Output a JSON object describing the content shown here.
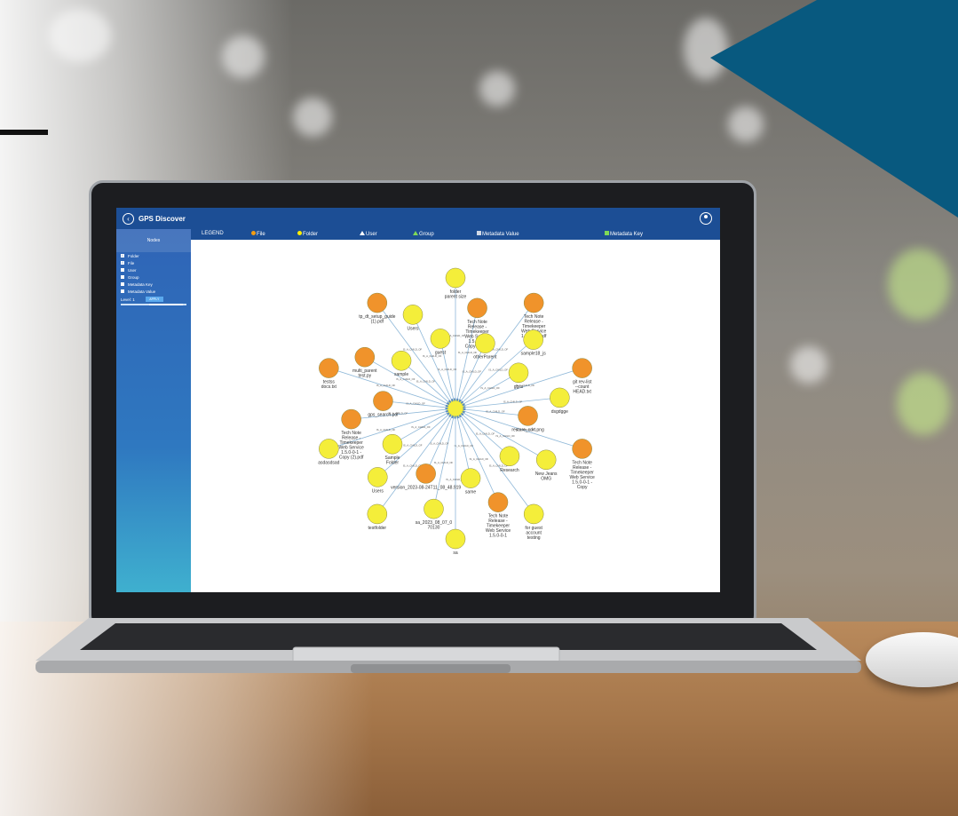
{
  "app": {
    "title": "GPS Discover"
  },
  "sidebar": {
    "header": "Nodes",
    "items": [
      {
        "label": "Folder",
        "checked": true
      },
      {
        "label": "File",
        "checked": true
      },
      {
        "label": "User",
        "checked": false
      },
      {
        "label": "Group",
        "checked": false
      },
      {
        "label": "Metadata Key",
        "checked": false
      },
      {
        "label": "Metadata Value",
        "checked": false
      }
    ],
    "level_label": "Level: 1",
    "apply_label": "APPLY"
  },
  "legend": {
    "title": "LEGEND",
    "items": [
      {
        "label": "File",
        "shape": "circle",
        "color": "#f39c12"
      },
      {
        "label": "Folder",
        "shape": "circle",
        "color": "#ffee00"
      },
      {
        "label": "User",
        "shape": "triangle",
        "color": "#ffffff"
      },
      {
        "label": "Group",
        "shape": "triangle",
        "color": "#7ed957"
      },
      {
        "label": "Metadata Value",
        "shape": "square",
        "color": "#cfd8e6"
      },
      {
        "label": "Metadata Key",
        "shape": "square",
        "color": "#7ed957"
      }
    ]
  },
  "graph": {
    "colors": {
      "file": "#f0932b",
      "folder": "#f4ee3a",
      "edge": "#8fb8d8"
    },
    "edge_label": "IS_A_CHILD_OF",
    "nodes": [
      {
        "type": "folder",
        "label": "folder parent size"
      },
      {
        "type": "file",
        "label": "Tech Note Release - Timekeeper Web Service 1.5.0-0-1 Copy (2).pdf"
      },
      {
        "type": "folder",
        "label": "otherParent"
      },
      {
        "type": "file",
        "label": "Tech Note Release - Timekeeper Web Service 1.5.0-0-1.pdf"
      },
      {
        "type": "folder",
        "label": "sample18_js"
      },
      {
        "type": "folder",
        "label": "ggss"
      },
      {
        "type": "file",
        "label": "git rev-list --count HEAD.txt"
      },
      {
        "type": "folder",
        "label": "dsgdgge"
      },
      {
        "type": "file",
        "label": "restore_cdrt.png"
      },
      {
        "type": "file",
        "label": "Tech Note Release - Timekeeper Web Service 1.5.0-0-1 - Copy"
      },
      {
        "type": "folder",
        "label": "New Jeans OMG"
      },
      {
        "type": "folder",
        "label": "Research"
      },
      {
        "type": "folder",
        "label": "for guest account testing"
      },
      {
        "type": "file",
        "label": "Tech Note Release - Timekeeper Web Service 1.5.0-0-1"
      },
      {
        "type": "folder",
        "label": "same"
      },
      {
        "type": "folder",
        "label": "sa"
      },
      {
        "type": "folder",
        "label": "sa_2023_08_07_0 70130"
      },
      {
        "type": "file",
        "label": "version_2023-08-24T11_08_48.919"
      },
      {
        "type": "folder",
        "label": "testfolder"
      },
      {
        "type": "folder",
        "label": "Users"
      },
      {
        "type": "folder",
        "label": "Sample Folder"
      },
      {
        "type": "folder",
        "label": "asdasdsad"
      },
      {
        "type": "file",
        "label": "Tech Note Release - Timekeeper Web Service 1.5.0-0-1 - Copy (2).pdf"
      },
      {
        "type": "file",
        "label": "gps_search.pdf"
      },
      {
        "type": "file",
        "label": "testss docs.txt"
      },
      {
        "type": "file",
        "label": "multi_parent test.py"
      },
      {
        "type": "folder",
        "label": "sample"
      },
      {
        "type": "file",
        "label": "tp_dt_setup_guide (1).pdf"
      },
      {
        "type": "folder",
        "label": "Users"
      },
      {
        "type": "folder",
        "label": "guest"
      }
    ]
  }
}
